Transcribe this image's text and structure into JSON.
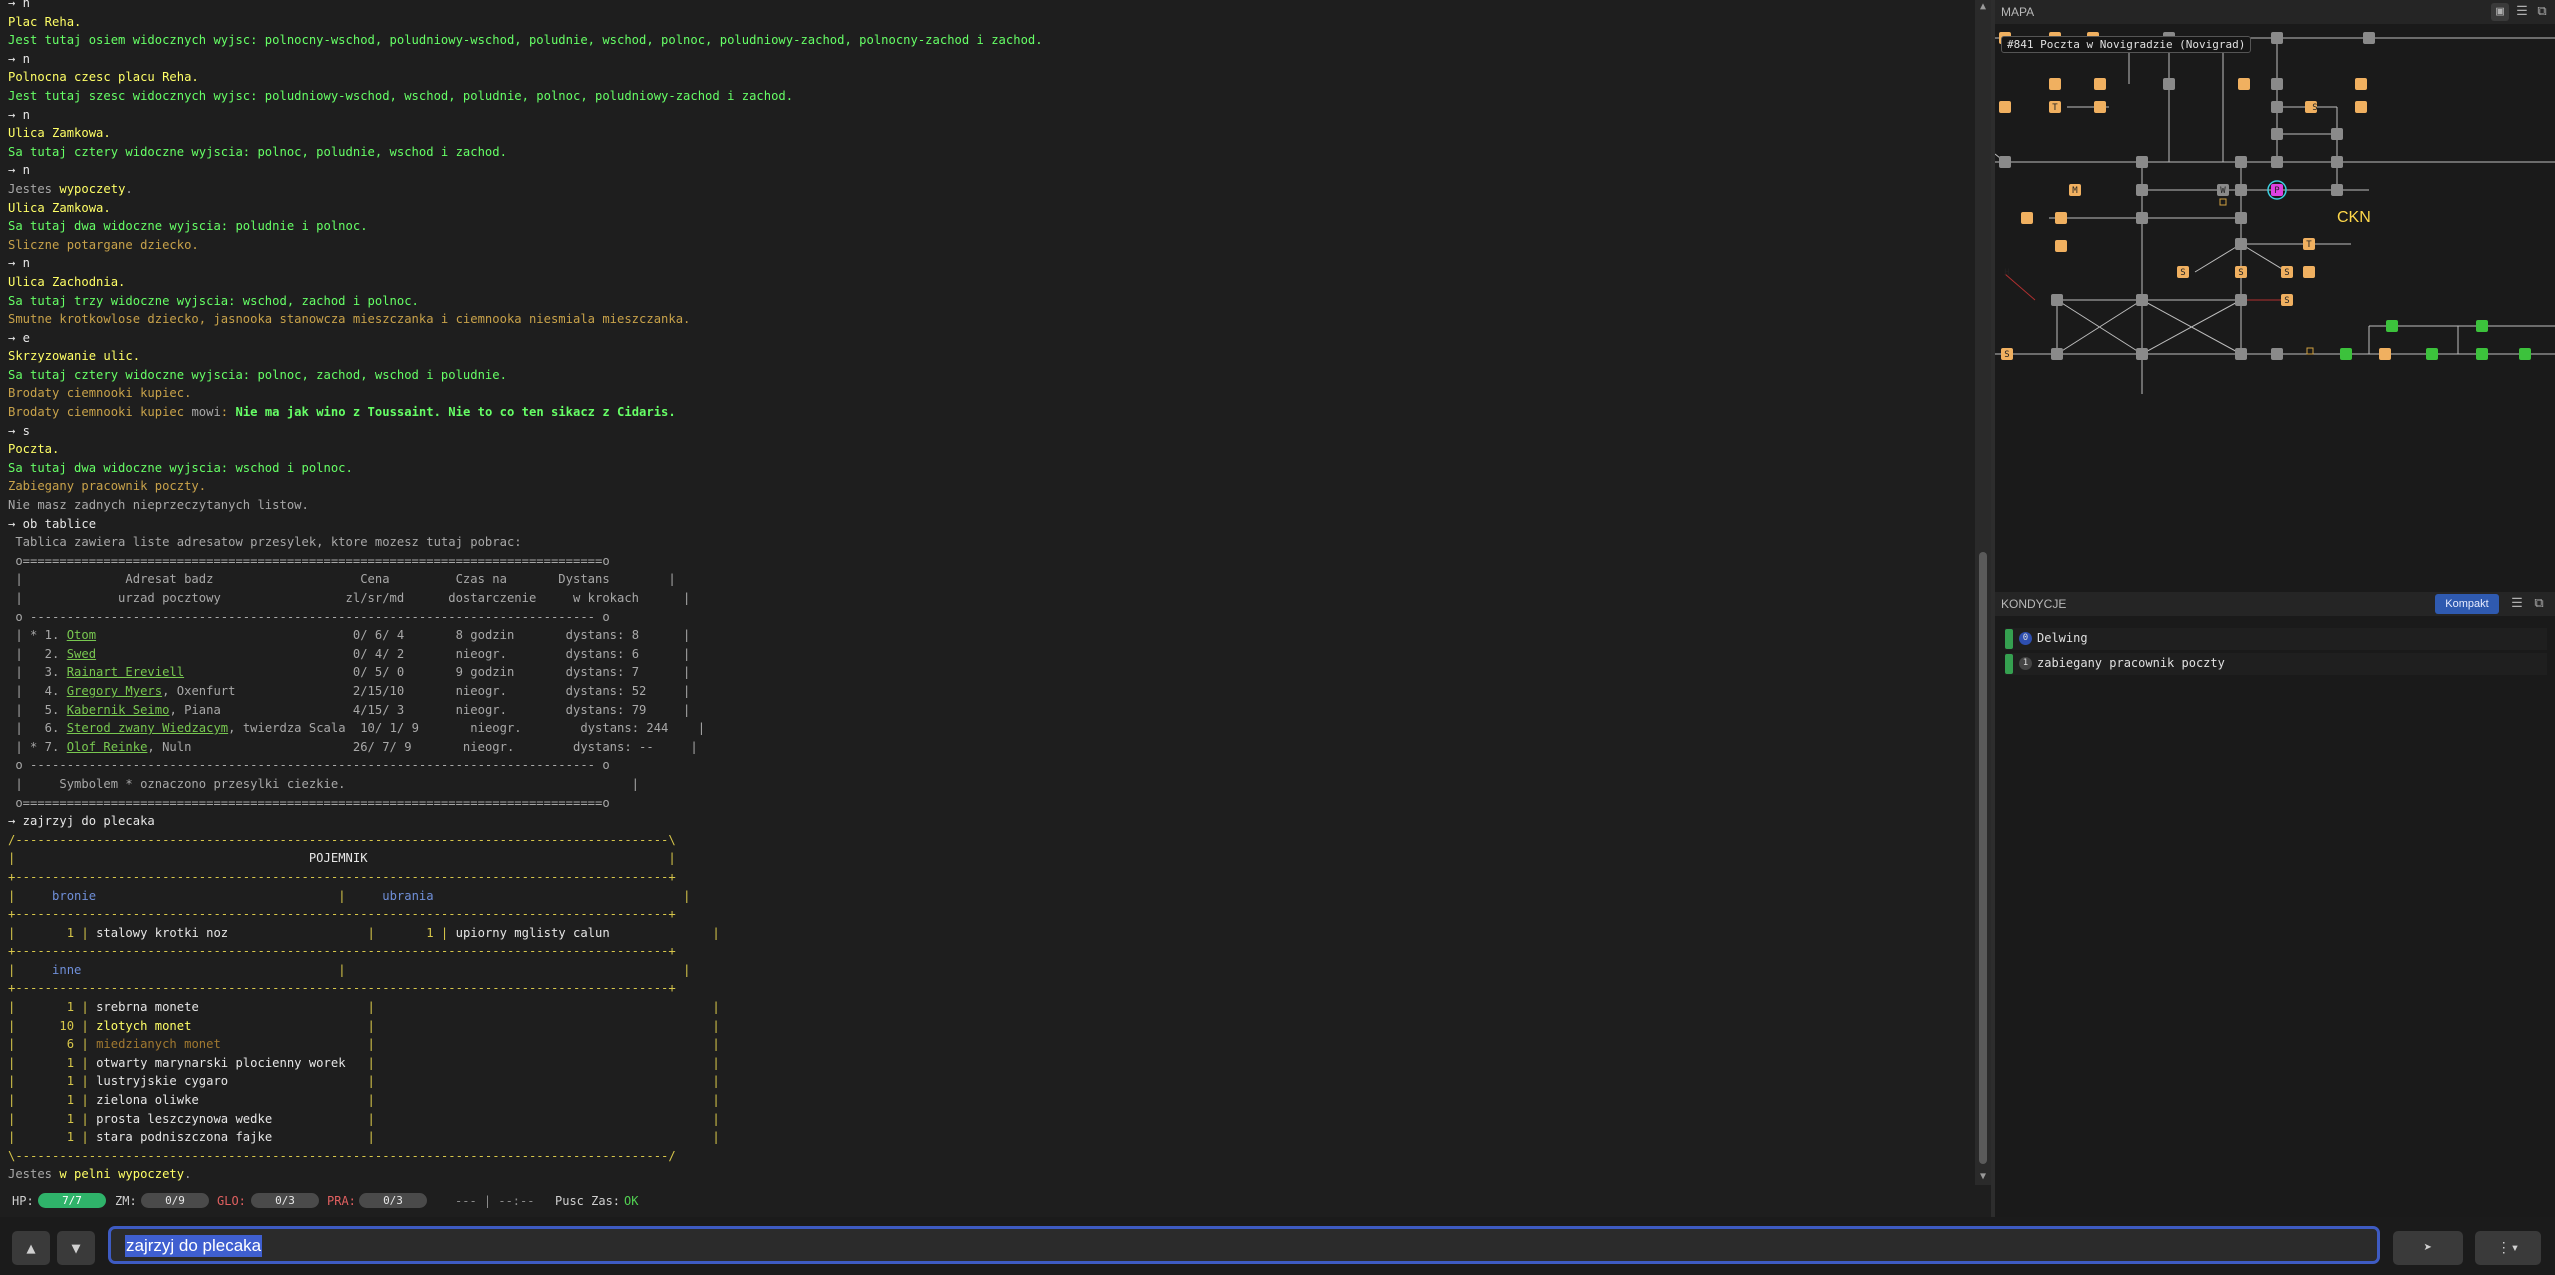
{
  "terminal": {
    "lines": [
      {
        "parts": [
          {
            "t": "→ n",
            "c": "w"
          }
        ]
      },
      {
        "parts": [
          {
            "t": "Plac Reha.",
            "c": "y"
          }
        ]
      },
      {
        "parts": [
          {
            "t": "Jest tutaj osiem widocznych wyjsc: polnocny-wschod, poludniowy-wschod, poludnie, wschod, polnoc, poludniowy-zachod, polnocny-zachod i zachod.",
            "c": "g"
          }
        ]
      },
      {
        "parts": [
          {
            "t": "→ n",
            "c": "w"
          }
        ]
      },
      {
        "parts": [
          {
            "t": "Polnocna czesc placu Reha.",
            "c": "y"
          }
        ]
      },
      {
        "parts": [
          {
            "t": "Jest tutaj szesc widocznych wyjsc: poludniowy-wschod, wschod, poludnie, polnoc, poludniowy-zachod i zachod.",
            "c": "g"
          }
        ]
      },
      {
        "parts": [
          {
            "t": "→ n",
            "c": "w"
          }
        ]
      },
      {
        "parts": [
          {
            "t": "Ulica Zamkowa.",
            "c": "y"
          }
        ]
      },
      {
        "parts": [
          {
            "t": "Sa tutaj cztery widoczne wyjscia: polnoc, poludnie, wschod i zachod.",
            "c": "g"
          }
        ]
      },
      {
        "parts": [
          {
            "t": "→ n",
            "c": "w"
          }
        ]
      },
      {
        "parts": [
          {
            "t": "Jestes ",
            "c": "gr"
          },
          {
            "t": "wypoczety",
            "c": "y"
          },
          {
            "t": ".",
            "c": "gr"
          }
        ]
      },
      {
        "parts": [
          {
            "t": "Ulica Zamkowa.",
            "c": "y"
          }
        ]
      },
      {
        "parts": [
          {
            "t": "Sa tutaj dwa widoczne wyjscia: poludnie i polnoc.",
            "c": "g"
          }
        ]
      },
      {
        "parts": [
          {
            "t": "Sliczne potargane dziecko.",
            "c": "or"
          }
        ]
      },
      {
        "parts": [
          {
            "t": "→ n",
            "c": "w"
          }
        ]
      },
      {
        "parts": [
          {
            "t": "Ulica Zachodnia.",
            "c": "y"
          }
        ]
      },
      {
        "parts": [
          {
            "t": "Sa tutaj trzy widoczne wyjscia: wschod, zachod i polnoc.",
            "c": "g"
          }
        ]
      },
      {
        "parts": [
          {
            "t": "Smutne krotkowlose dziecko, jasnooka stanowcza mieszczanka i ciemnooka niesmiala mieszczanka.",
            "c": "or"
          }
        ]
      },
      {
        "parts": [
          {
            "t": "→ e",
            "c": "w"
          }
        ]
      },
      {
        "parts": [
          {
            "t": "Skrzyzowanie ulic.",
            "c": "y"
          }
        ]
      },
      {
        "parts": [
          {
            "t": "Sa tutaj cztery widoczne wyjscia: polnoc, zachod, wschod i poludnie.",
            "c": "g"
          }
        ]
      },
      {
        "parts": [
          {
            "t": "Brodaty ciemnooki kupiec.",
            "c": "or"
          }
        ]
      },
      {
        "parts": [
          {
            "t": "Brodaty ciemnooki kupiec ",
            "c": "or"
          },
          {
            "t": "mowi",
            "c": "gr"
          },
          {
            "t": ": ",
            "c": "or"
          },
          {
            "t": "Nie ma jak wino z Toussaint. Nie to co ten sikacz z Cidaris.",
            "c": "gb"
          }
        ]
      },
      {
        "parts": [
          {
            "t": "→ s",
            "c": "w"
          }
        ]
      },
      {
        "parts": [
          {
            "t": "Poczta.",
            "c": "y"
          }
        ]
      },
      {
        "parts": [
          {
            "t": "Sa tutaj dwa widoczne wyjscia: wschod i polnoc.",
            "c": "g"
          }
        ]
      },
      {
        "parts": [
          {
            "t": "Zabiegany pracownik poczty.",
            "c": "or"
          }
        ]
      },
      {
        "parts": [
          {
            "t": "Nie masz zadnych nieprzeczytanych listow.",
            "c": "gr"
          }
        ]
      },
      {
        "parts": [
          {
            "t": "→ ob tablice",
            "c": "w"
          }
        ]
      },
      {
        "parts": [
          {
            "t": " Tablica zawiera liste adresatow przesylek, ktore mozesz tutaj pobrac:",
            "c": "gr"
          }
        ]
      },
      {
        "parts": [
          {
            "t": " o===============================================================================o",
            "c": "gr"
          }
        ]
      },
      {
        "parts": [
          {
            "t": " |              Adresat badz                    Cena         Czas na       Dystans        |",
            "c": "gr"
          }
        ]
      },
      {
        "parts": [
          {
            "t": " |             urzad pocztowy                 zl/sr/md      dostarczenie     w krokach      |",
            "c": "gr"
          }
        ]
      },
      {
        "parts": [
          {
            "t": " o ----------------------------------------------------------------------------- o",
            "c": "gr"
          }
        ]
      },
      {
        "parts": [
          {
            "t": " | * 1. ",
            "c": "gr"
          },
          {
            "t": "Otom",
            "c": "lk"
          },
          {
            "t": "                                   0/ 6/ 4       8 godzin       dystans: 8      |",
            "c": "gr"
          }
        ]
      },
      {
        "parts": [
          {
            "t": " |   2. ",
            "c": "gr"
          },
          {
            "t": "Swed",
            "c": "lk"
          },
          {
            "t": "                                   0/ 4/ 2       nieogr.        dystans: 6      |",
            "c": "gr"
          }
        ]
      },
      {
        "parts": [
          {
            "t": " |   3. ",
            "c": "gr"
          },
          {
            "t": "Rainart Ereviell",
            "c": "lk"
          },
          {
            "t": "                       0/ 5/ 0       9 godzin       dystans: 7      |",
            "c": "gr"
          }
        ]
      },
      {
        "parts": [
          {
            "t": " |   4. ",
            "c": "gr"
          },
          {
            "t": "Gregory Myers",
            "c": "lk"
          },
          {
            "t": ", Oxenfurt                2/15/10       nieogr.        dystans: 52     |",
            "c": "gr"
          }
        ]
      },
      {
        "parts": [
          {
            "t": " |   5. ",
            "c": "gr"
          },
          {
            "t": "Kabernik Seimo",
            "c": "lk"
          },
          {
            "t": ", Piana                  4/15/ 3       nieogr.        dystans: 79     |",
            "c": "gr"
          }
        ]
      },
      {
        "parts": [
          {
            "t": " |   6. ",
            "c": "gr"
          },
          {
            "t": "Sterod zwany Wiedzacym",
            "c": "lk"
          },
          {
            "t": ", twierdza Scala  10/ 1/ 9       nieogr.        dystans: 244    |",
            "c": "gr"
          }
        ]
      },
      {
        "parts": [
          {
            "t": " | * 7. ",
            "c": "gr"
          },
          {
            "t": "Olof Reinke",
            "c": "lk"
          },
          {
            "t": ", Nuln                      26/ 7/ 9       nieogr.        dystans: --     |",
            "c": "gr"
          }
        ]
      },
      {
        "parts": [
          {
            "t": " o ----------------------------------------------------------------------------- o",
            "c": "gr"
          }
        ]
      },
      {
        "parts": [
          {
            "t": " |     Symbolem * oznaczono przesylki ciezkie.                                       |",
            "c": "gr"
          }
        ]
      },
      {
        "parts": [
          {
            "t": " o===============================================================================o",
            "c": "gr"
          }
        ]
      },
      {
        "parts": [
          {
            "t": "→ zajrzyj do plecaka",
            "c": "w"
          }
        ]
      },
      {
        "parts": [
          {
            "t": "/-----------------------------------------------------------------------------------------\\",
            "c": "yd"
          }
        ]
      },
      {
        "parts": [
          {
            "t": "|                                        ",
            "c": "yd"
          },
          {
            "t": "POJEMNIK",
            "c": "w"
          },
          {
            "t": "                                         |",
            "c": "yd"
          }
        ]
      },
      {
        "parts": [
          {
            "t": "+-----------------------------------------------------------------------------------------+",
            "c": "yd"
          }
        ]
      },
      {
        "parts": [
          {
            "t": "|     ",
            "c": "yd"
          },
          {
            "t": "bronie",
            "c": "bl"
          },
          {
            "t": "                                 |     ",
            "c": "yd"
          },
          {
            "t": "ubrania",
            "c": "bl"
          },
          {
            "t": "                                  |",
            "c": "yd"
          }
        ]
      },
      {
        "parts": [
          {
            "t": "+-----------------------------------------------------------------------------------------+",
            "c": "yd"
          }
        ]
      },
      {
        "parts": [
          {
            "t": "|       1 | ",
            "c": "yd"
          },
          {
            "t": "stalowy krotki noz",
            "c": "w"
          },
          {
            "t": "                   |       1 | ",
            "c": "yd"
          },
          {
            "t": "upiorny mglisty calun",
            "c": "w"
          },
          {
            "t": "              |",
            "c": "yd"
          }
        ]
      },
      {
        "parts": [
          {
            "t": "+-----------------------------------------------------------------------------------------+",
            "c": "yd"
          }
        ]
      },
      {
        "parts": [
          {
            "t": "|     ",
            "c": "yd"
          },
          {
            "t": "inne",
            "c": "bl"
          },
          {
            "t": "                                   |                                              |",
            "c": "yd"
          }
        ]
      },
      {
        "parts": [
          {
            "t": "+-----------------------------------------------------------------------------------------+",
            "c": "yd"
          }
        ]
      },
      {
        "parts": [
          {
            "t": "|       1 | ",
            "c": "yd"
          },
          {
            "t": "srebrna monete",
            "c": "w"
          },
          {
            "t": "                       |                                              |",
            "c": "yd"
          }
        ]
      },
      {
        "parts": [
          {
            "t": "|      10 | ",
            "c": "yd"
          },
          {
            "t": "zlotych monet",
            "c": "y"
          },
          {
            "t": "                        |                                              |",
            "c": "yd"
          }
        ]
      },
      {
        "parts": [
          {
            "t": "|       6 | ",
            "c": "yd"
          },
          {
            "t": "miedzianych monet",
            "c": "br"
          },
          {
            "t": "                    |                                              |",
            "c": "yd"
          }
        ]
      },
      {
        "parts": [
          {
            "t": "|       1 | ",
            "c": "yd"
          },
          {
            "t": "otwarty marynarski plocienny worek",
            "c": "w"
          },
          {
            "t": "   |                                              |",
            "c": "yd"
          }
        ]
      },
      {
        "parts": [
          {
            "t": "|       1 | ",
            "c": "yd"
          },
          {
            "t": "lustryjskie cygaro",
            "c": "w"
          },
          {
            "t": "                   |                                              |",
            "c": "yd"
          }
        ]
      },
      {
        "parts": [
          {
            "t": "|       1 | ",
            "c": "yd"
          },
          {
            "t": "zielona oliwke",
            "c": "w"
          },
          {
            "t": "                       |                                              |",
            "c": "yd"
          }
        ]
      },
      {
        "parts": [
          {
            "t": "|       1 | ",
            "c": "yd"
          },
          {
            "t": "prosta leszczynowa wedke",
            "c": "w"
          },
          {
            "t": "             |                                              |",
            "c": "yd"
          }
        ]
      },
      {
        "parts": [
          {
            "t": "|       1 | ",
            "c": "yd"
          },
          {
            "t": "stara podniszczona fajke",
            "c": "w"
          },
          {
            "t": "             |                                              |",
            "c": "yd"
          }
        ]
      },
      {
        "parts": [
          {
            "t": "\\-----------------------------------------------------------------------------------------/",
            "c": "yd"
          }
        ]
      },
      {
        "parts": [
          {
            "t": "Jestes ",
            "c": "gr"
          },
          {
            "t": "w pelni wypoczety",
            "c": "y"
          },
          {
            "t": ".",
            "c": "gr"
          }
        ]
      }
    ]
  },
  "status": {
    "hp_label": "HP:",
    "hp_value": "7/7",
    "zm_label": "ZM:",
    "zm_value": "0/9",
    "glo_label": "GLO:",
    "glo_value": "0/3",
    "pra_label": "PRA:",
    "pra_value": "0/3",
    "dashes": "---  |  --:--",
    "pusc_label": "Pusc Zas:",
    "pusc_value": "OK"
  },
  "input": {
    "up": "▲",
    "down": "▼",
    "value": "zajrzyj do plecaka",
    "send": "➤",
    "more": "⋮▾"
  },
  "map": {
    "title": "MAPA",
    "location": "#841 Poczta w Novigradzie (Novigrad)",
    "area_label": "CKN",
    "header_icons": [
      "image-icon",
      "menu-icon",
      "popout-icon"
    ],
    "room_letters": [
      "T",
      "M",
      "W",
      "H",
      "S",
      "T",
      "S",
      "S",
      "S",
      "S",
      "S",
      "P"
    ]
  },
  "conditions": {
    "title": "KONDYCJE",
    "compact_button": "Kompakt",
    "items": [
      {
        "num": "0",
        "label": "Delwing"
      },
      {
        "num": "1",
        "label": "zabiegany pracownik poczty"
      }
    ]
  },
  "colors": {
    "accent": "#3e5bc2",
    "hp_green": "#2fb36a",
    "room_gray": "#8a8a8a",
    "room_orange": "#f0b060",
    "room_green": "#3cc23c",
    "player": "#e040e0"
  }
}
